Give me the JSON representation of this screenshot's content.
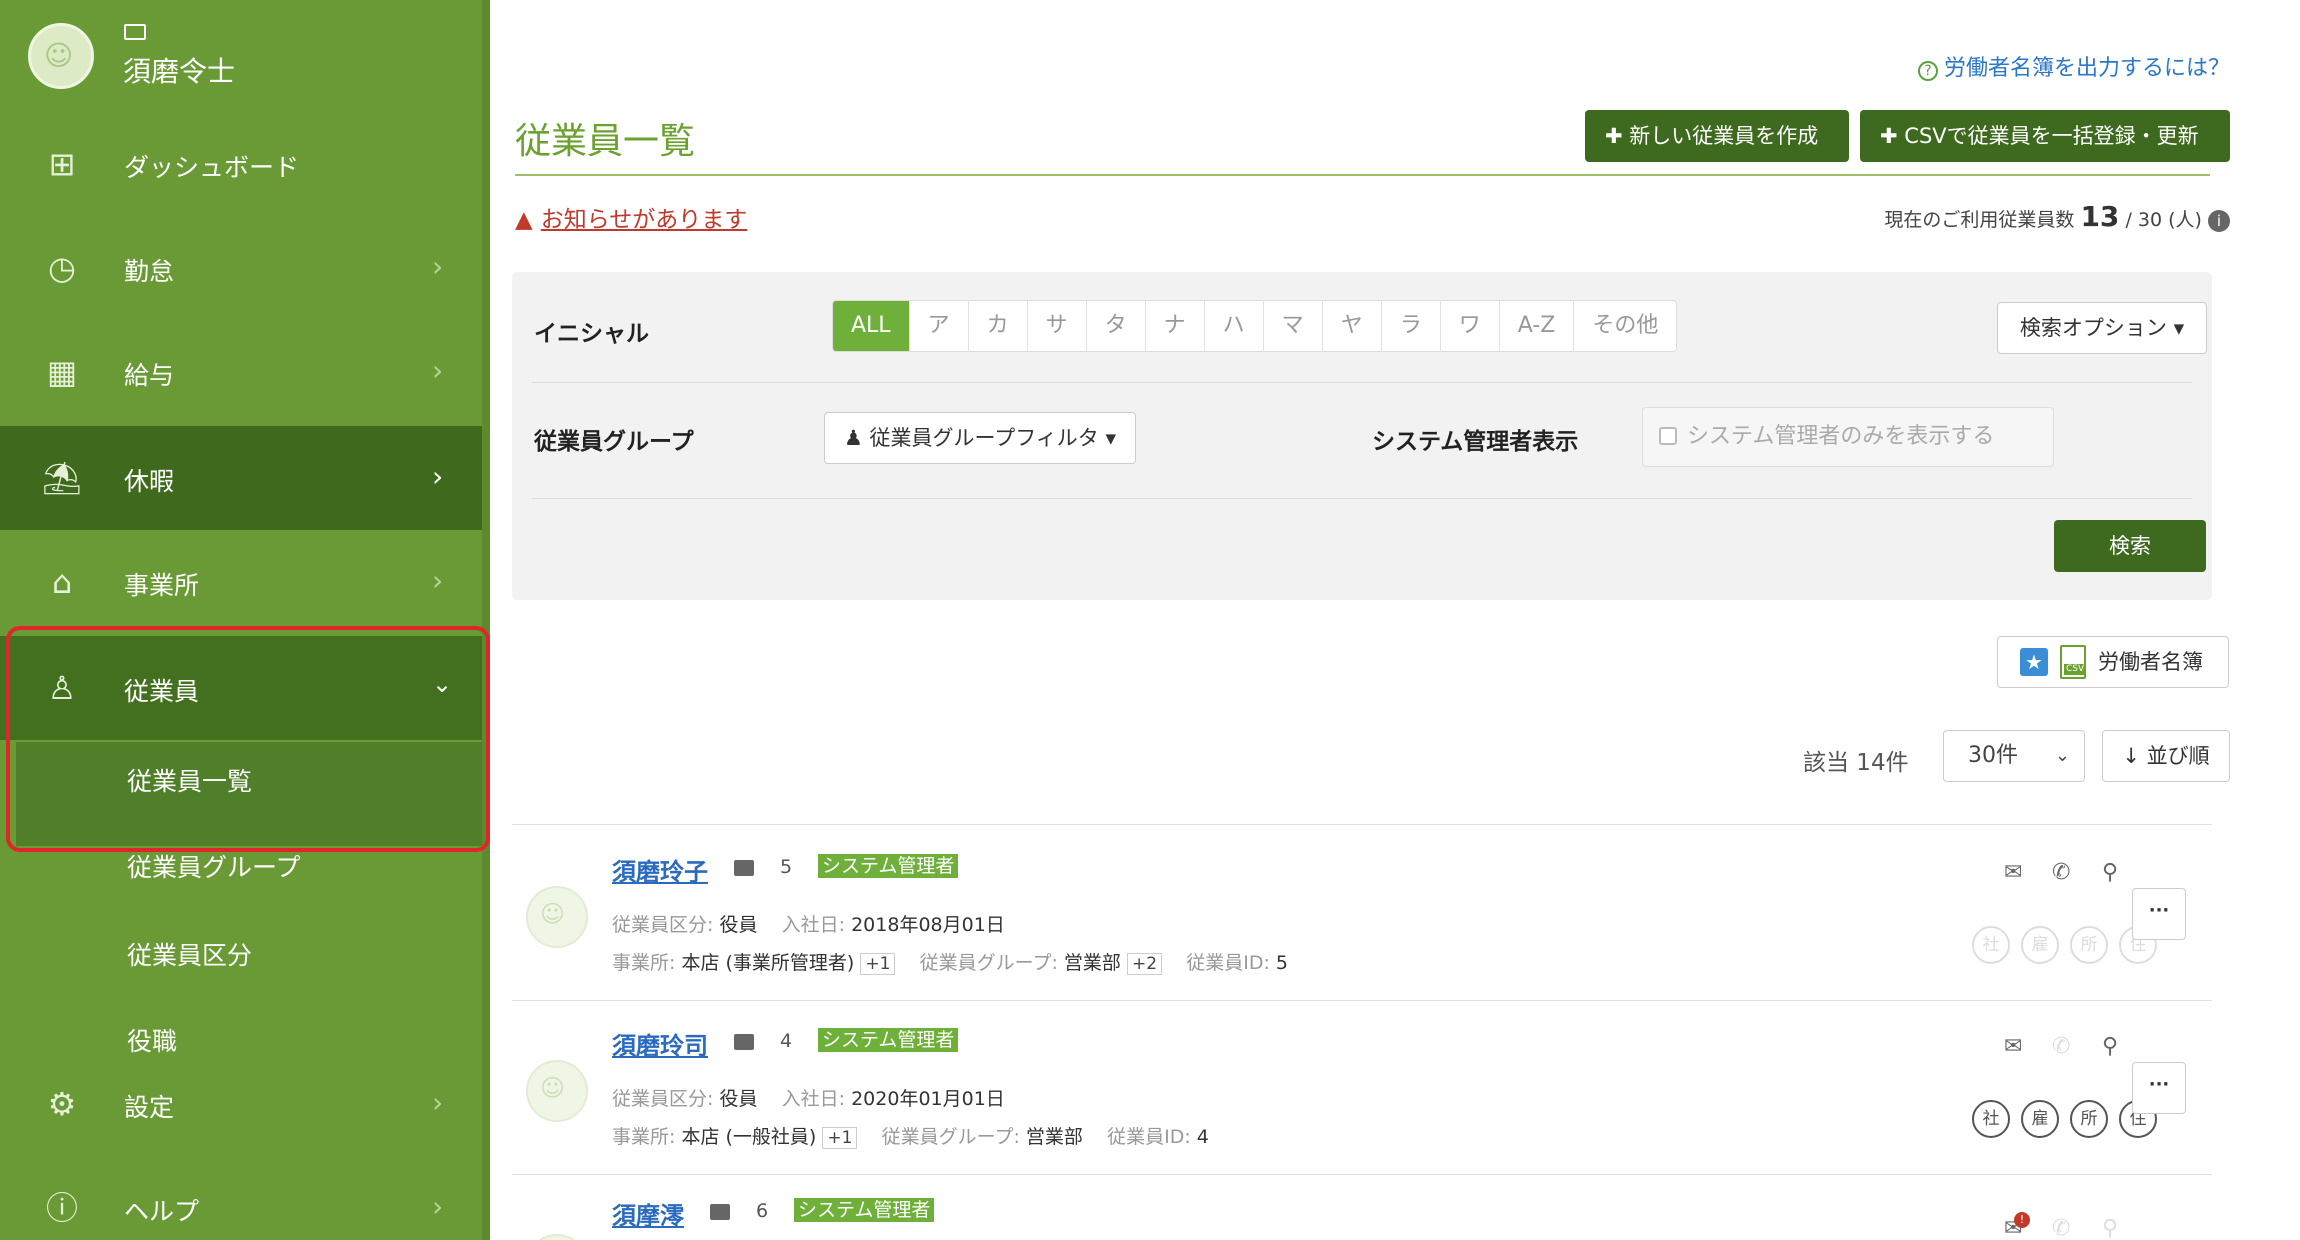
{
  "sidebar": {
    "user_name": "須磨令士",
    "nav": [
      {
        "label": "ダッシュボード",
        "icon": "dashboard-icon"
      },
      {
        "label": "勤怠",
        "icon": "clock-icon"
      },
      {
        "label": "給与",
        "icon": "calculator-icon"
      },
      {
        "label": "休暇",
        "icon": "beach-umbrella-icon"
      },
      {
        "label": "事業所",
        "icon": "home-icon"
      },
      {
        "label": "従業員",
        "icon": "person-icon"
      },
      {
        "label": "設定",
        "icon": "gear-icon"
      },
      {
        "label": "ヘルプ",
        "icon": "help-circle-icon"
      }
    ],
    "sub_items": [
      "従業員一覧",
      "従業員グループ",
      "従業員区分",
      "役職"
    ]
  },
  "header": {
    "help_link": "労働者名簿を出力するには？",
    "title": "従業員一覧",
    "new_button": "新しい従業員を作成",
    "csv_button": "CSVで従業員を一括登録・更新",
    "notice": "お知らせがあります",
    "usage_label": "現在のご利用従業員数",
    "usage_current": "13",
    "usage_total": "/ 30 (人)"
  },
  "filters": {
    "initial_label": "イニシャル",
    "initials": [
      "ALL",
      "ア",
      "カ",
      "サ",
      "タ",
      "ナ",
      "ハ",
      "マ",
      "ヤ",
      "ラ",
      "ワ",
      "A-Z",
      "その他"
    ],
    "search_options": "検索オプション",
    "group_label": "従業員グループ",
    "group_filter": "従業員グループフィルタ",
    "admin_label": "システム管理者表示",
    "admin_checkbox": "システム管理者のみを表示する",
    "search_button": "検索"
  },
  "list": {
    "roster_button": "労働者名簿",
    "result_count": "該当 14件",
    "per_page": "30件",
    "sort_button": "並び順"
  },
  "employees": [
    {
      "name": "須磨玲子",
      "number": "5",
      "badge": "システム管理者",
      "kubun_label": "従業員区分:",
      "kubun": "役員",
      "join_label": "入社日:",
      "join": "2018年08月01日",
      "office_label": "事業所:",
      "office": "本店 (事業所管理者)",
      "office_plus": "+1",
      "group_label": "従業員グループ:",
      "group": "営業部",
      "group_plus": "+2",
      "id_label": "従業員ID:",
      "id": "5",
      "tags": [
        "社",
        "雇",
        "所",
        "住"
      ]
    },
    {
      "name": "須磨玲司",
      "number": "4",
      "badge": "システム管理者",
      "kubun_label": "従業員区分:",
      "kubun": "役員",
      "join_label": "入社日:",
      "join": "2020年01月01日",
      "office_label": "事業所:",
      "office": "本店 (一般社員)",
      "office_plus": "+1",
      "group_label": "従業員グループ:",
      "group": "営業部",
      "id_label": "従業員ID:",
      "id": "4",
      "tags": [
        "社",
        "雇",
        "所",
        "住"
      ]
    },
    {
      "name": "須摩澪",
      "number": "6",
      "badge": "システム管理者"
    }
  ],
  "colors": {
    "sidebar": "#6a9a35",
    "sidebar_active": "#3f6a1e",
    "primary_button": "#3e6a1f",
    "accent_green": "#6fb03a",
    "highlight_red": "#e0262a"
  }
}
